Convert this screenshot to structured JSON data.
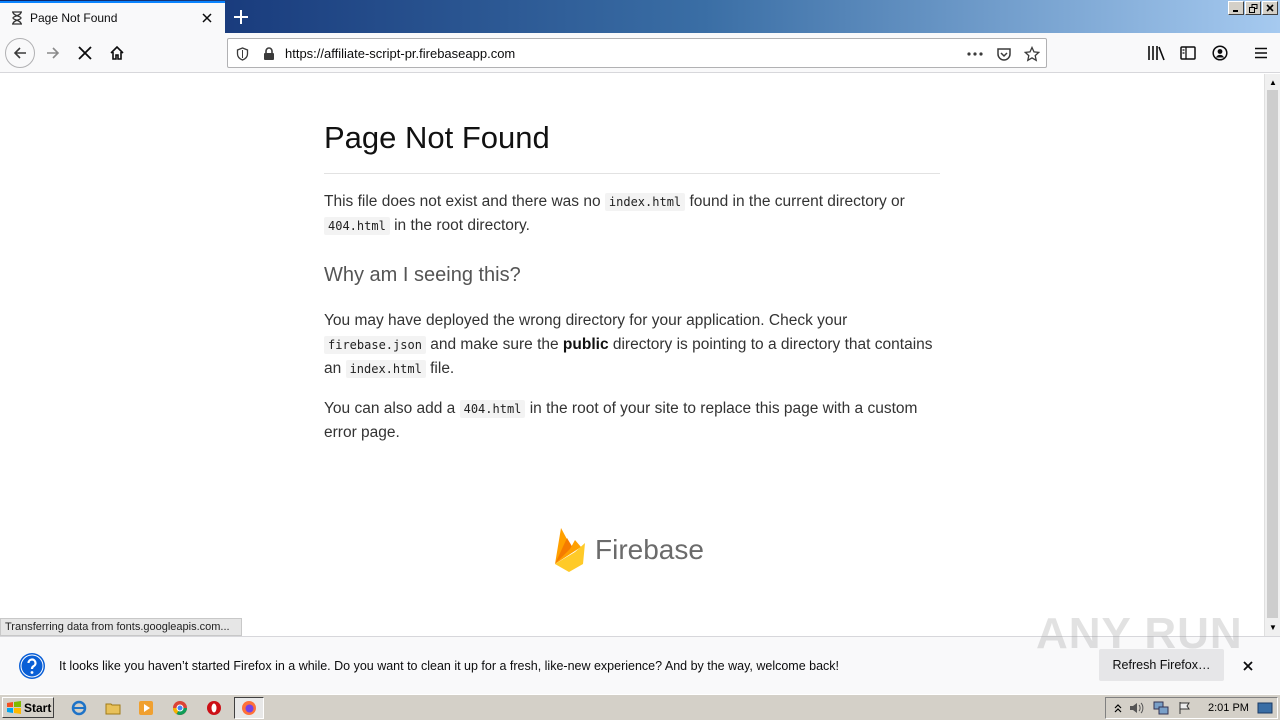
{
  "browser": {
    "tab": {
      "title": "Page Not Found"
    },
    "url": "https://affiliate-script-pr.firebaseapp.com"
  },
  "page": {
    "title": "Page Not Found",
    "intro_1": "This file does not exist and there was no ",
    "intro_code_1": "index.html",
    "intro_2": " found in the current directory or ",
    "intro_code_2": "404.html",
    "intro_3": " in the root directory.",
    "subtitle": "Why am I seeing this?",
    "para1_1": "You may have deployed the wrong directory for your application. Check your ",
    "para1_code_1": "firebase.json",
    "para1_2": " and make sure the ",
    "para1_bold": "public",
    "para1_3": " directory is pointing to a directory that contains an ",
    "para1_code_2": "index.html",
    "para1_4": " file.",
    "para2_1": "You can also add a ",
    "para2_code": "404.html",
    "para2_2": " in the root of your site to replace this page with a custom error page.",
    "brand": "Firebase"
  },
  "status_text": "Transferring data from fonts.googleapis.com...",
  "notification": {
    "message": "It looks like you haven’t started Firefox in a while. Do you want to clean it up for a fresh, like-new experience? And by the way, welcome back!",
    "button": "Refresh Firefox…"
  },
  "watermark": "ANY RUN",
  "taskbar": {
    "start_label": "Start",
    "clock": "2:01 PM"
  },
  "colors": {
    "accent": "#0a84ff",
    "firebase_yellow": "#ffca28",
    "firebase_orange": "#ffa000",
    "notif_icon": "#0a5fd6"
  }
}
